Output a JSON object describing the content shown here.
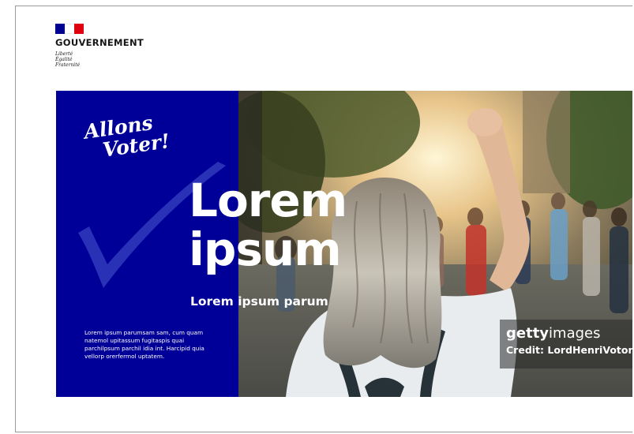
{
  "logo": {
    "name": "GOUVERNEMENT",
    "motto": [
      "Liberté",
      "Égalité",
      "Fraternité"
    ],
    "flag_colors": [
      "#000091",
      "#ffffff",
      "#e1000f"
    ]
  },
  "banner": {
    "script_title": [
      "Allons",
      "Voter!"
    ],
    "title_lines": [
      "Lorem",
      "ipsum"
    ],
    "subtitle": "Lorem ipsum parum",
    "body": "Lorem ipsum parumsam sam, cum quam natemol upitassum fugitaspis quai parchilpsum parchil idia int. Harcipid quia vellorp orerfermol uptatem.",
    "panel_color": "#000099",
    "photo_icon": "photo-protester-raised-fist",
    "checkmark_icon": "checkmark-icon"
  },
  "watermark": {
    "brand_bold": "getty",
    "brand_light": "images",
    "credit": "Credit: LordHenriVoton"
  }
}
